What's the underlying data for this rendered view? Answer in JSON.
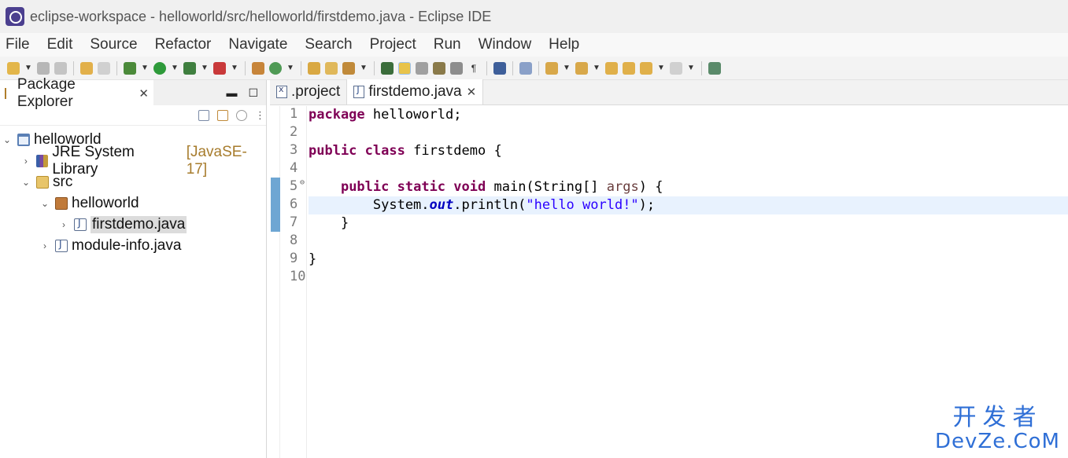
{
  "window": {
    "title": "eclipse-workspace - helloworld/src/helloworld/firstdemo.java - Eclipse IDE"
  },
  "menu": [
    "File",
    "Edit",
    "Source",
    "Refactor",
    "Navigate",
    "Search",
    "Project",
    "Run",
    "Window",
    "Help"
  ],
  "explorer": {
    "tab_label": "Package Explorer",
    "tree": {
      "project": "helloworld",
      "jre": "JRE System Library",
      "jre_version": "[JavaSE-17]",
      "src": "src",
      "package": "helloworld",
      "file_selected": "firstdemo.java",
      "module_info": "module-info.java"
    }
  },
  "editor": {
    "tabs": [
      ".project",
      "firstdemo.java"
    ],
    "line_numbers": [
      "1",
      "2",
      "3",
      "4",
      "5",
      "6",
      "7",
      "8",
      "9",
      "10"
    ],
    "code": {
      "l1_kw": "package",
      "l1_rest": " helloworld;",
      "l3_kw1": "public",
      "l3_kw2": "class",
      "l3_rest": " firstdemo {",
      "l5_kw1": "public",
      "l5_kw2": "static",
      "l5_kw3": "void",
      "l5_a": " main(String[] ",
      "l5_param": "args",
      "l5_b": ") {",
      "l6_a": "        System.",
      "l6_field": "out",
      "l6_b": ".println(",
      "l6_str": "\"hello world!\"",
      "l6_c": ");",
      "l7": "    }",
      "l9": "}"
    }
  },
  "watermark": {
    "top": "开发者",
    "bottom": "DevZe.CoM"
  }
}
